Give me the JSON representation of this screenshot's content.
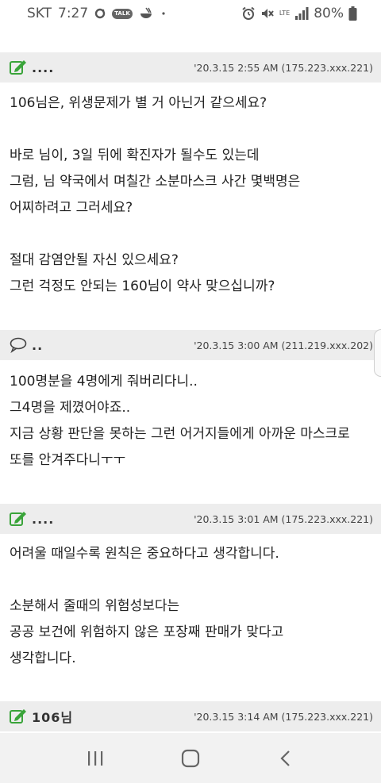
{
  "status_bar": {
    "carrier": "SKT",
    "time": "7:27",
    "talk_label": "TALK",
    "network": "LTE",
    "battery": "80%",
    "icons": [
      "instagram-icon",
      "kakaotalk-icon",
      "bowl-icon",
      "dot-icon",
      "alarm-icon",
      "mute-icon",
      "lte-icon",
      "signal-icon",
      "battery-icon"
    ]
  },
  "comments": [
    {
      "nickname": "....",
      "icon": "edit-icon",
      "meta": "'20.3.15 2:55 AM (175.223.xxx.221)",
      "lines": [
        "106님은, 위생문제가 별 거 아닌거 같으세요?",
        "",
        "바로 님이, 3일 뒤에 확진자가 될수도 있는데",
        "그럼, 님 약국에서 며칠간 소분마스크 사간 몇백명은",
        "어찌하려고 그러세요?",
        "",
        "절대 감염안될 자신 있으세요?",
        "그런 걱정도 안되는 160님이 약사 맞으십니까?"
      ]
    },
    {
      "nickname": "..",
      "icon": "speech-bubble-icon",
      "meta": "'20.3.15 3:00 AM (211.219.xxx.202)",
      "lines": [
        "100명분을 4명에게 줘버리다니..",
        "그4명을 제꼈어야죠..",
        "지금 상황 판단을 못하는 그런 어거지들에게 아까운 마스크로",
        "또를 안겨주다니ㅜㅜ"
      ]
    },
    {
      "nickname": "....",
      "icon": "edit-icon",
      "meta": "'20.3.15 3:01 AM (175.223.xxx.221)",
      "lines": [
        "어려울 때일수록 원칙은 중요하다고 생각합니다.",
        "",
        "소분해서 줄때의 위험성보다는",
        "공공 보건에 위험하지 않은 포장째 판매가 맞다고",
        "생각합니다."
      ]
    },
    {
      "nickname": "106님",
      "icon": "edit-icon",
      "meta": "'20.3.15 3:14 AM (175.223.xxx.221)",
      "lines": []
    }
  ],
  "nav_bar": {
    "recent": "recent-apps-icon",
    "home": "home-icon",
    "back": "back-icon"
  },
  "colors": {
    "header_bg": "#ededed",
    "edit_icon_green": "#3aa43a",
    "text": "#222222",
    "navbar_bg": "#f2f2f2"
  }
}
